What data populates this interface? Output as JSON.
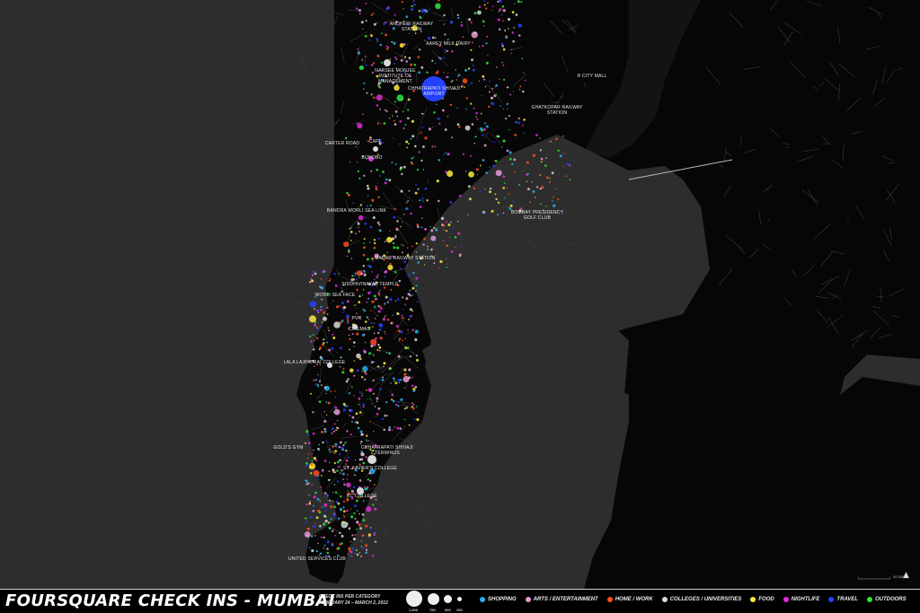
{
  "title": "FOURSQUARE CHECK INS - MUMBAI",
  "subtitle_line1": "CHECK INS PER CATEGORY",
  "subtitle_line2": "FEBRUARY 24 – MARCH 2, 2012",
  "size_legend": [
    "1,000",
    "750",
    "500",
    "250"
  ],
  "categories": [
    {
      "label": "SHOPPING",
      "color": "#2ab0e6"
    },
    {
      "label": "ARTS / ENTERTAINMENT",
      "color": "#e79ad6"
    },
    {
      "label": "HOME / WORK",
      "color": "#ff4d1f"
    },
    {
      "label": "COLLEGES / UNIVERSITIES",
      "color": "#d9d9d9"
    },
    {
      "label": "FOOD",
      "color": "#ffe93c"
    },
    {
      "label": "NIGHTLIFE",
      "color": "#e02ed6"
    },
    {
      "label": "TRAVEL",
      "color": "#2540ff"
    },
    {
      "label": "OUTDOORS",
      "color": "#2ee63a"
    }
  ],
  "places": [
    {
      "name": "ANDHERI RAILWAY STATION"
    },
    {
      "name": "AAREY MILK DAIRY"
    },
    {
      "name": "NARSEE MONJEE INSTITUTE OF MANAGEMENT"
    },
    {
      "name": "CHHATRAPATI SHIVAJI AIRPORT"
    },
    {
      "name": "R CITY MALL"
    },
    {
      "name": "GHATKOPAR RAILWAY STATION"
    },
    {
      "name": "CARTER ROAD"
    },
    {
      "name": "CAFE"
    },
    {
      "name": "BONOBO"
    },
    {
      "name": "BANDRA WORLI SEA LINK"
    },
    {
      "name": "BOMBAY PRESIDENCY GOLF CLUB"
    },
    {
      "name": "DADAR RAILWAY STATION"
    },
    {
      "name": "SIDDHIVINAYAK TEMPLE"
    },
    {
      "name": "WORLI SEA FACE"
    },
    {
      "name": "PVR"
    },
    {
      "name": "CINEMAS"
    },
    {
      "name": "LALA LAJPATRAI COLLEGE"
    },
    {
      "name": "GOLD'S GYM"
    },
    {
      "name": "CHHATRAPATI SHIVAJI TERMINUS"
    },
    {
      "name": "ST. XAVIER'S COLLEGE"
    },
    {
      "name": "KC COLLEGE"
    },
    {
      "name": "UNITED SERVICES CLUB"
    }
  ],
  "scale_label": "40,000"
}
